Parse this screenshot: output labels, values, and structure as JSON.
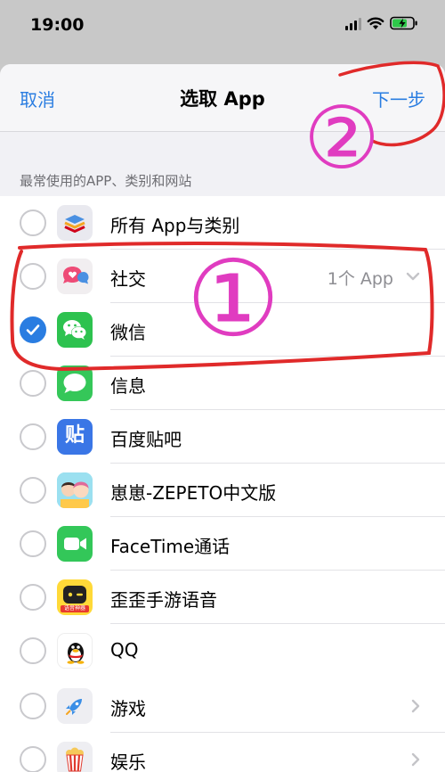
{
  "status_bar": {
    "time": "19:00"
  },
  "nav": {
    "cancel": "取消",
    "title": "选取 App",
    "next": "下一步"
  },
  "section_header": "最常使用的APP、类别和网站",
  "rows": [
    {
      "label": "所有 App与类别"
    },
    {
      "label": "社交",
      "count": "1个 App"
    },
    {
      "label": "微信",
      "checked": true
    },
    {
      "label": "信息"
    },
    {
      "label": "百度贴吧",
      "icon_text": "贴"
    },
    {
      "label": "崽崽-ZEPETO中文版"
    },
    {
      "label": "FaceTime通话"
    },
    {
      "label": "歪歪手游语音",
      "icon_text": "语音神器"
    },
    {
      "label": "QQ"
    },
    {
      "label": "游戏"
    },
    {
      "label": "娱乐"
    }
  ],
  "annotations": {
    "circle_1": "①",
    "circle_2": "②"
  },
  "colors": {
    "accent": "#2a7de1",
    "annotation_red": "#e02a2a",
    "annotation_magenta": "#e03cc0"
  },
  "icons": [
    "layers-icon",
    "social-chat-icon",
    "wechat-icon",
    "messages-icon",
    "tieba-icon",
    "zepeto-icon",
    "facetime-icon",
    "yy-icon",
    "qq-penguin-icon",
    "rocket-icon",
    "popcorn-icon"
  ]
}
